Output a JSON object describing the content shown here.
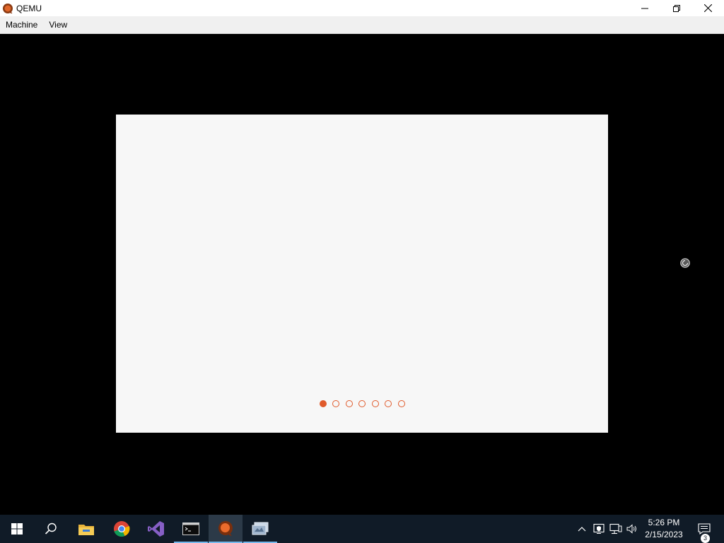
{
  "window": {
    "title": "QEMU",
    "icon": "qemu-icon",
    "controls": {
      "minimize_icon": "minimize-icon",
      "restore_icon": "restore-icon",
      "close_icon": "close-icon"
    }
  },
  "menubar": {
    "items": [
      {
        "label": "Machine"
      },
      {
        "label": "View"
      }
    ]
  },
  "vm_screen": {
    "background": "#000000",
    "dialog": {
      "background": "#f7f7f7",
      "pager": {
        "total": 7,
        "active_index": 0,
        "accent_color": "#e05a2b"
      }
    },
    "busy_cursor_icon": "busy-cursor-icon"
  },
  "taskbar": {
    "background": "#101b27",
    "apps": [
      {
        "icon": "windows-start-icon"
      },
      {
        "icon": "search-icon"
      },
      {
        "icon": "file-explorer-icon"
      },
      {
        "icon": "chrome-icon"
      },
      {
        "icon": "visual-studio-icon"
      },
      {
        "icon": "terminal-icon"
      },
      {
        "icon": "qemu-icon"
      },
      {
        "icon": "remote-desktop-icon"
      }
    ],
    "tray": {
      "icons": [
        "chevron-up-icon",
        "security-icon",
        "network-icon",
        "volume-icon"
      ],
      "time": "5:26 PM",
      "date": "2/15/2023",
      "notification_count": "3"
    }
  }
}
